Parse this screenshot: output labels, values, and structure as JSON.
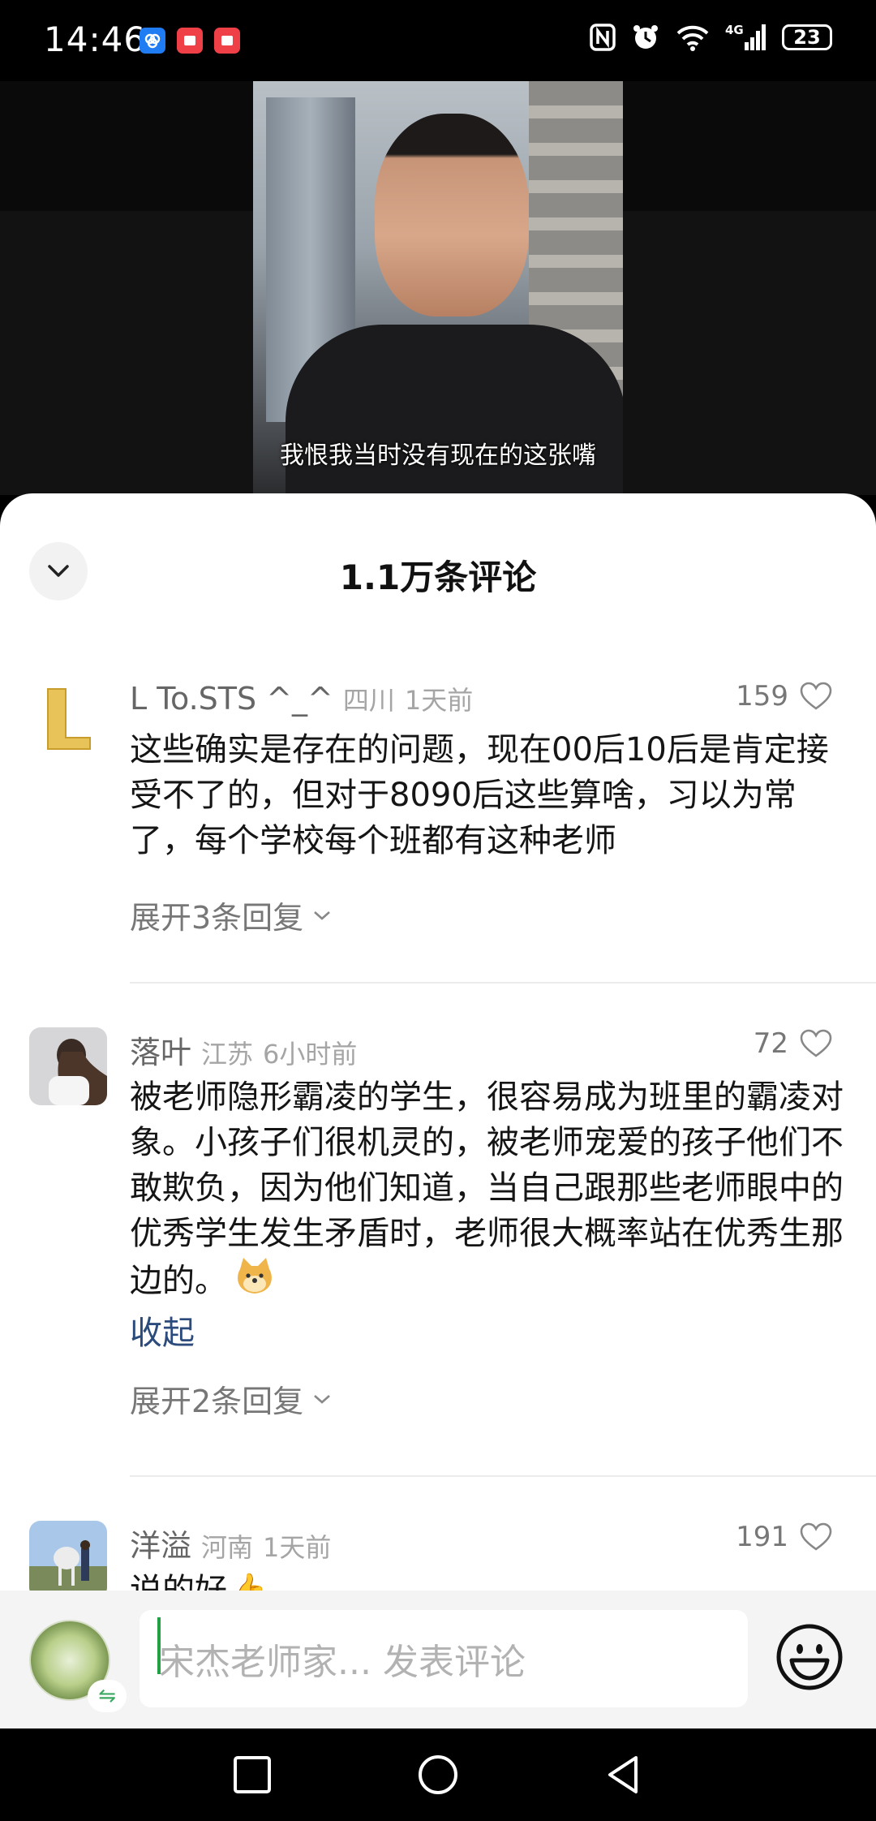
{
  "status": {
    "time": "14:46",
    "battery": "23",
    "network": "4G"
  },
  "video": {
    "subtitle": "我恨我当时没有现在的这张嘴"
  },
  "comments_header": {
    "title": "1.1万条评论"
  },
  "comments": [
    {
      "user": "L To.STS ^_^",
      "location": "四川",
      "time": "1天前",
      "likes": "159",
      "text": "这些确实是存在的问题，现在00后10后是肯定接受不了的，但对于8090后这些算啥，习以为常了，每个学校每个班都有这种老师",
      "replies": "展开3条回复"
    },
    {
      "user": "落叶",
      "location": "江苏",
      "time": "6小时前",
      "likes": "72",
      "text": "被老师隐形霸凌的学生，很容易成为班里的霸凌对象。小孩子们很机灵的，被老师宠爱的孩子他们不敢欺负，因为他们知道，当自己跟那些老师眼中的优秀学生发生矛盾时，老师很大概率站在优秀生那边的。",
      "collapse": "收起",
      "replies": "展开2条回复"
    },
    {
      "user": "洋溢",
      "location": "河南",
      "time": "1天前",
      "likes": "191",
      "text": "说的好👍"
    }
  ],
  "input": {
    "placeholder": "宋杰老师家... 发表评论"
  },
  "colors": {
    "accent": "#22a043",
    "link": "#2b4b7d"
  }
}
